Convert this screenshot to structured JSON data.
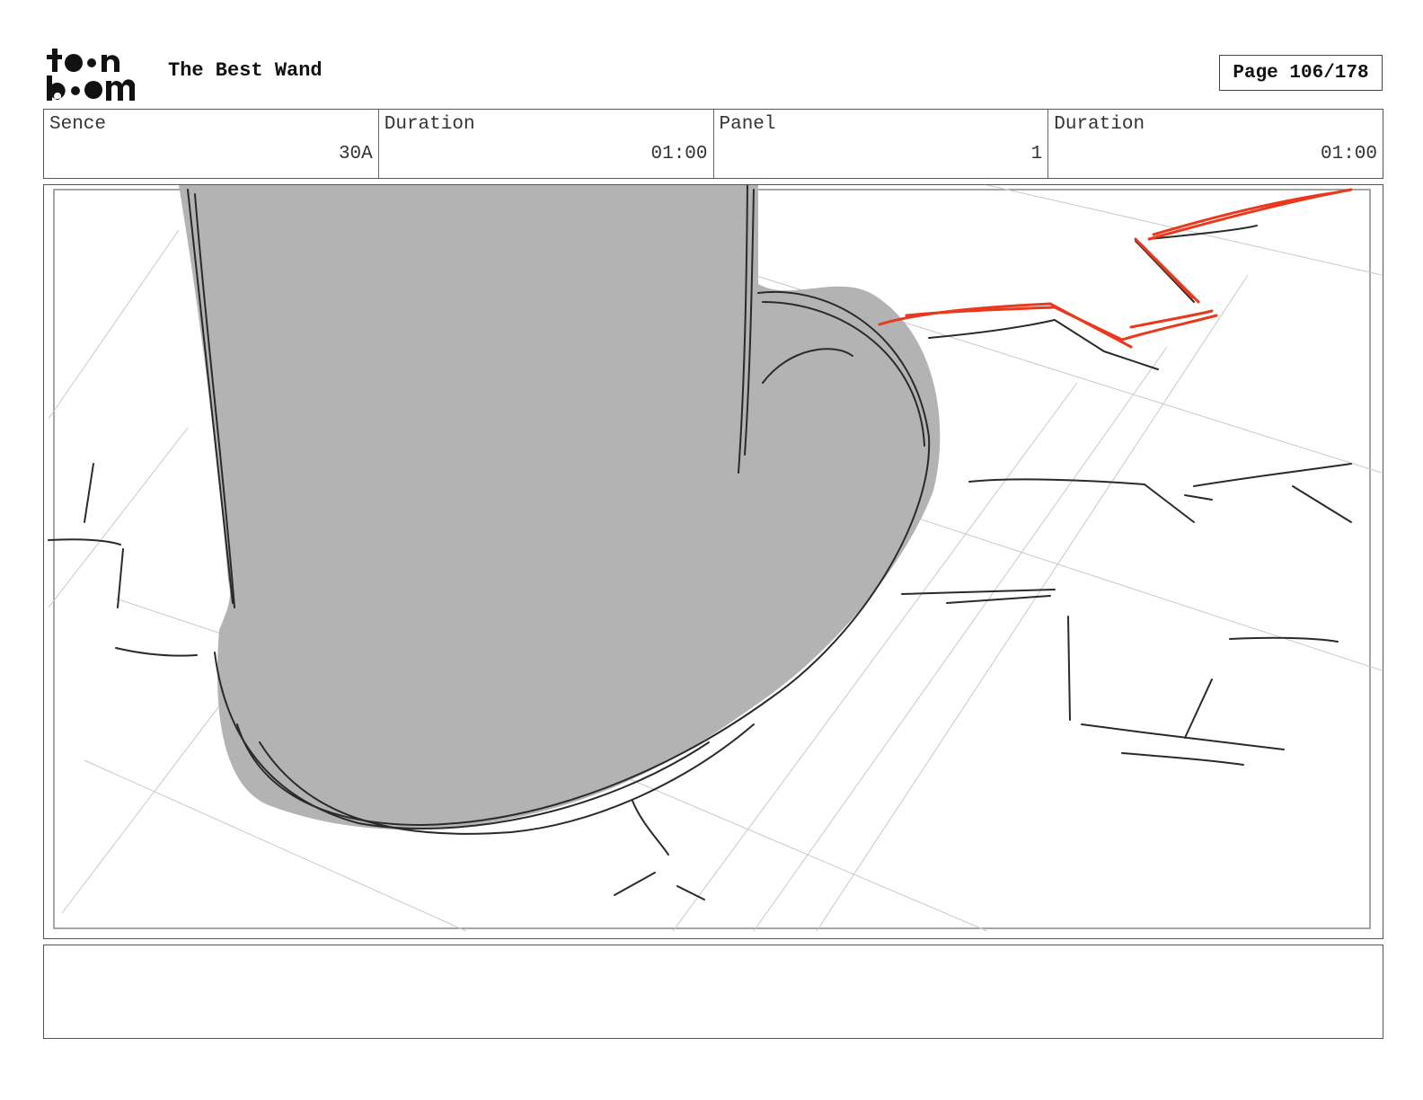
{
  "header": {
    "logo": {
      "line1": "toon",
      "line2": "boom"
    },
    "title": "The Best Wand",
    "page_indicator": "Page 106/178"
  },
  "info": {
    "scene_label": "Sence",
    "scene_value": "30A",
    "scene_duration_label": "Duration",
    "scene_duration_value": "01:00",
    "panel_label": "Panel",
    "panel_value": "1",
    "panel_duration_label": "Duration",
    "panel_duration_value": "01:00"
  },
  "panel": {
    "image_icon": "storyboard-sketch-boot",
    "colors": {
      "fill": "#b3b3b3",
      "ink": "#2a2a2a",
      "accent": "#e8391d",
      "guide": "#c8c8c8"
    }
  },
  "notes": {
    "text": ""
  }
}
